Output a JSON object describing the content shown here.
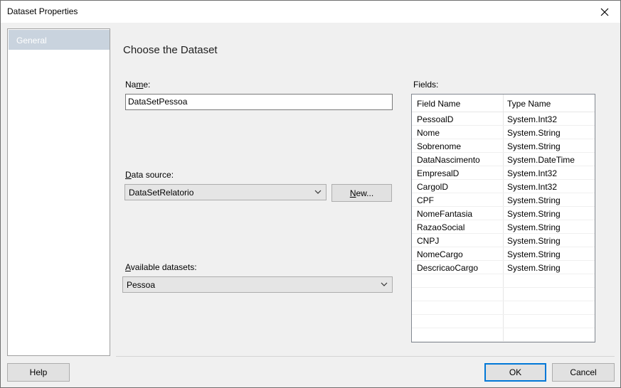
{
  "window": {
    "title": "Dataset Properties"
  },
  "nav": {
    "items": [
      {
        "label": "General"
      }
    ]
  },
  "main": {
    "heading": "Choose the Dataset",
    "name": {
      "label_pre": "Na",
      "label_mnemonic": "m",
      "label_post": "e:",
      "value": "DataSetPessoa"
    },
    "data_source": {
      "label_mnemonic": "D",
      "label_post": "ata source:",
      "value": "DataSetRelatorio",
      "new_pre": "",
      "new_mnemonic": "N",
      "new_post": "ew..."
    },
    "available_datasets": {
      "label_mnemonic": "A",
      "label_post": "vailable datasets:",
      "value": "Pessoa"
    }
  },
  "fields": {
    "label": "Fields:",
    "columns": [
      "Field Name",
      "Type Name"
    ],
    "rows": [
      {
        "name": "PessoalD",
        "type": "System.Int32"
      },
      {
        "name": "Nome",
        "type": "System.String"
      },
      {
        "name": "Sobrenome",
        "type": "System.String"
      },
      {
        "name": "DataNascimento",
        "type": "System.DateTime"
      },
      {
        "name": "EmpresalD",
        "type": "System.Int32"
      },
      {
        "name": "CargolD",
        "type": "System.Int32"
      },
      {
        "name": "CPF",
        "type": "System.String"
      },
      {
        "name": "NomeFantasia",
        "type": "System.String"
      },
      {
        "name": "RazaoSocial",
        "type": "System.String"
      },
      {
        "name": "CNPJ",
        "type": "System.String"
      },
      {
        "name": "NomeCargo",
        "type": "System.String"
      },
      {
        "name": "DescricaoCargo",
        "type": "System.String"
      }
    ]
  },
  "footer": {
    "help_label": "Help",
    "ok_label": "OK",
    "cancel_label": "Cancel"
  },
  "icons": {
    "close": "close-icon",
    "dropdown": "chevron-down-icon"
  },
  "colors": {
    "nav_selected_bg": "#c9d3de",
    "default_button_border": "#0078d7"
  }
}
